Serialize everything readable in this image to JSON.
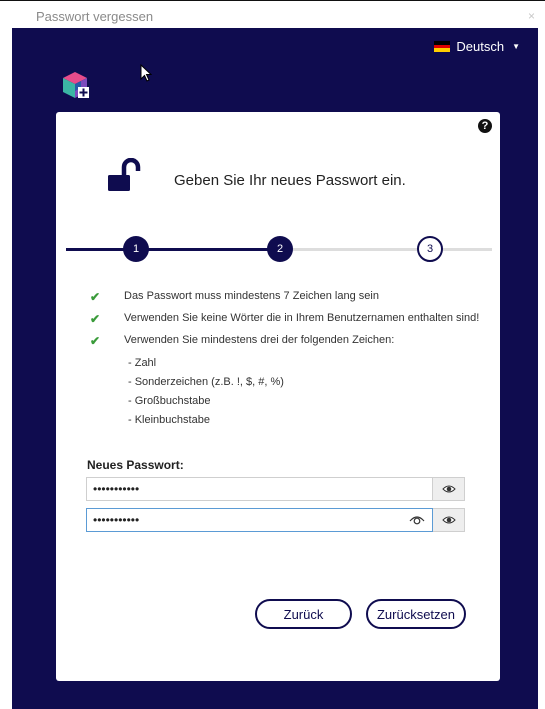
{
  "window": {
    "title": "Passwort vergessen",
    "close_glyph": "×"
  },
  "language": {
    "label": "Deutsch",
    "flag": [
      "#000000",
      "#dd0000",
      "#ffce00"
    ]
  },
  "colors": {
    "brand": "#0f0c4f",
    "check": "#3a9b3a",
    "focus": "#5b9bd5"
  },
  "card": {
    "help_glyph": "?",
    "heading": "Geben Sie Ihr neues Passwort ein.",
    "steps": [
      "1",
      "2",
      "3"
    ],
    "current_step": 3,
    "requirements": [
      "Das Passwort muss mindestens 7 Zeichen lang sein",
      "Verwenden Sie keine Wörter die in Ihrem Benutzernamen enthalten sind!",
      "Verwenden Sie mindestens drei der folgenden Zeichen:"
    ],
    "char_types": [
      "- Zahl",
      "- Sonderzeichen (z.B. !, $, #, %)",
      "- Großbuchstabe",
      "- Kleinbuchstabe"
    ],
    "password_label": "Neues Passwort:",
    "password_value": "•••••••••••",
    "confirm_value": "•••••••••••",
    "back_label": "Zurück",
    "reset_label": "Zurücksetzen"
  },
  "icons": [
    "lock-open-icon",
    "help-icon",
    "eye-icon",
    "check-icon",
    "app-logo-icon",
    "cursor-icon"
  ]
}
